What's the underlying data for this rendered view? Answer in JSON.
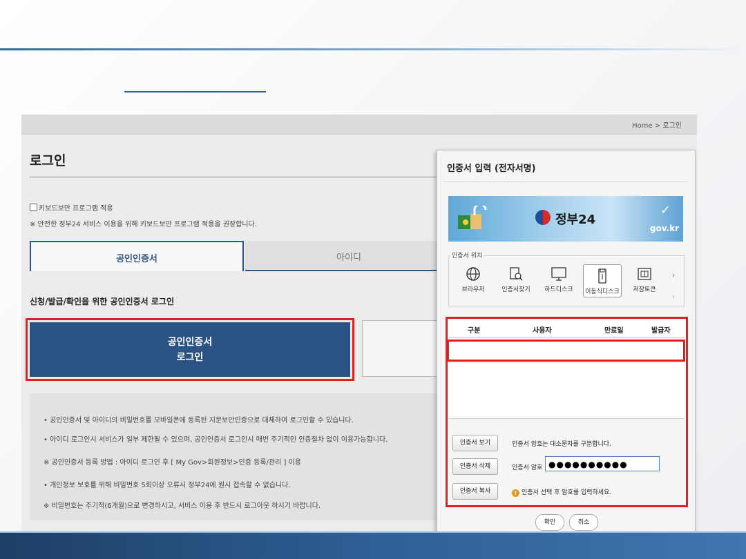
{
  "page": {
    "breadcrumb": "Home > 로그인",
    "title": "로그인",
    "keyboard_security_checkbox": "키보드보안 프로그램 적용",
    "keyboard_security_note": "※ 안전한 정부24 서비스 이용을 위해 키보드보안 프로그램 적용을 권장합니다.",
    "tabs": [
      {
        "label": "공인인증서"
      },
      {
        "label": "아이디"
      }
    ],
    "subtitle": "신청/발급/확인을 위한 공인인증서 로그인",
    "cert_login_button": {
      "line1": "공인인증서",
      "line2": "로그인"
    },
    "notices": [
      "• 공인인증서 및 아이디의 비밀번호를 모바일폰에 등록된 지문보안인증으로 대체하여 로그인할 수 있습니다.",
      "• 아이디 로그인시 서비스가 일부 제한될 수 있으며, 공인인증서 로그인시 매번 주기적인 인증절차 없이 이용가능합니다.",
      "※ 공인인증서 등록 방법 : 아이디 로그인 후 [ My Gov>회원정보>인증 등록/관리 ] 이용",
      "• 개인정보 보호를 위해 비밀번호 5회이상 오류시 정부24에 원시 접속할 수 없습니다.",
      "※ 비밀번호는 주기적(6개월)으로 변경하시고, 서비스 이용 후 반드시 로그아웃 하시기 바랍니다."
    ]
  },
  "dialog": {
    "title": "인증서 입력 (전자서명)",
    "banner_brand": "정부24",
    "banner_domain": "gov.kr",
    "location_label": "인증서 위치",
    "locations": [
      {
        "label": "브라우저",
        "icon": "globe-icon"
      },
      {
        "label": "인증서찾기",
        "icon": "find-cert-icon"
      },
      {
        "label": "하드디스크",
        "icon": "monitor-icon"
      },
      {
        "label": "이동식디스크",
        "icon": "usb-icon"
      },
      {
        "label": "저장토큰",
        "icon": "token-icon"
      }
    ],
    "table_headers": [
      "구분",
      "사용자",
      "만료일",
      "발급자"
    ],
    "buttons": {
      "view_cert": "인증서 보기",
      "delete_cert": "인증서 삭제",
      "copy_cert": "인증서 복사",
      "confirm": "확인",
      "cancel": "취소"
    },
    "case_note": "인증서 암호는 대소문자를 구분합니다.",
    "password_label": "인증서 암호",
    "password_value": "●●●●●●●●●●",
    "warning_text": "인증서 선택 후 암호를 입력하세요."
  },
  "colors": {
    "primary_blue": "#2a5282",
    "highlight_red": "#e02020"
  }
}
